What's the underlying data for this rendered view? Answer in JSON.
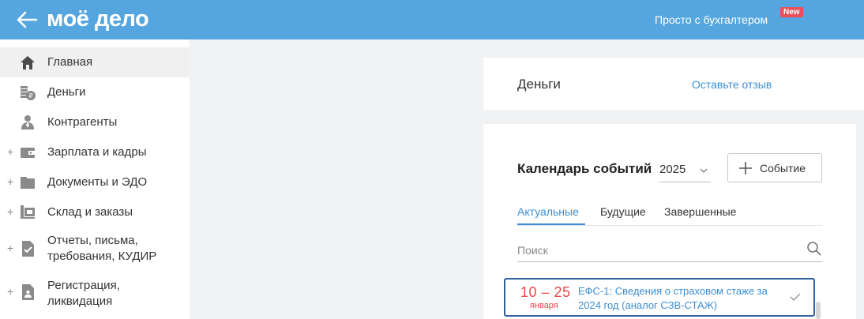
{
  "header": {
    "logo": "моё дело",
    "promo_label": "Просто с бухгалтером",
    "new_badge": "New"
  },
  "sidebar": {
    "items": [
      {
        "label": "Главная",
        "icon": "home-icon",
        "expandable": false,
        "active": true
      },
      {
        "label": "Деньги",
        "icon": "coins-icon",
        "expandable": false
      },
      {
        "label": "Контрагенты",
        "icon": "contractor-icon",
        "expandable": false
      },
      {
        "label": "Зарплата и кадры",
        "icon": "wallet-icon",
        "expandable": true
      },
      {
        "label": "Документы и ЭДО",
        "icon": "folder-icon",
        "expandable": true
      },
      {
        "label": "Склад и заказы",
        "icon": "cart-icon",
        "expandable": true
      },
      {
        "label": "Отчеты, письма, требования, КУДИР",
        "icon": "report-icon",
        "expandable": true
      },
      {
        "label": "Регистрация, ликвидация",
        "icon": "registration-icon",
        "expandable": true
      }
    ]
  },
  "money_card": {
    "title": "Деньги",
    "feedback_link": "Оставьте отзыв"
  },
  "calendar": {
    "title": "Календарь событий",
    "year": "2025",
    "add_event_label": "Событие",
    "tabs": [
      "Актуальные",
      "Будущие",
      "Завершенные"
    ],
    "active_tab": "Актуальные",
    "search_placeholder": "Поиск",
    "events": [
      {
        "date_range": "10 – 25",
        "month": "января",
        "text": "ЕФС-1: Сведения о страховом стаже за 2024 год (аналог СЗВ-СТАЖ)"
      }
    ]
  },
  "colors": {
    "header_bg": "#55a6de",
    "accent": "#3c8fd4",
    "date_red": "#e54a4a",
    "badge_red": "#e8505b",
    "selected_border": "#2f5f9e"
  }
}
